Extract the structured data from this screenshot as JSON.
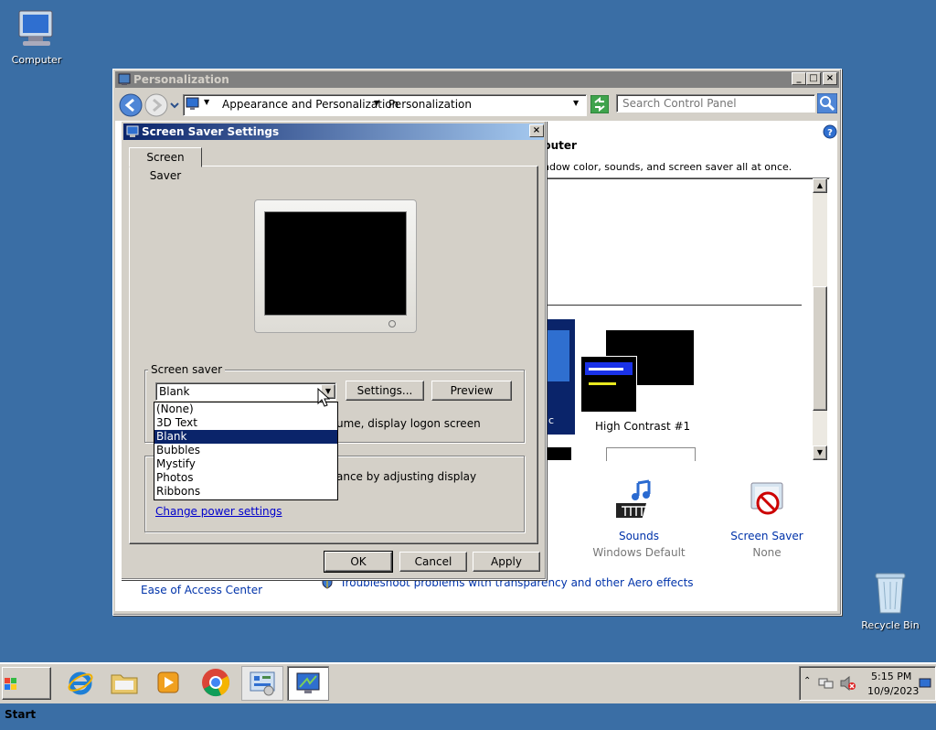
{
  "desktop": {
    "computer_label": "Computer",
    "recycle_label": "Recycle Bin"
  },
  "personalization": {
    "title": "Personalization",
    "breadcrumb": [
      "Appearance and Personalization",
      "Personalization"
    ],
    "search_placeholder": "Search Control Panel",
    "heading_fragment": "puter",
    "subtitle_fragment": "ndow color, sounds, and screen saver all at once.",
    "theme_partial_text": "ic",
    "theme_high_contrast": "High Contrast #1",
    "sounds_label": "Sounds",
    "sounds_value": "Windows Default",
    "screensaver_label": "Screen Saver",
    "screensaver_value": "None",
    "ease_link": "Ease of Access Center",
    "troubleshoot_link": "Troubleshoot problems with transparency and other Aero effects"
  },
  "dialog": {
    "title": "Screen Saver Settings",
    "tab": "Screen Saver",
    "group_label": "Screen saver",
    "selected": "Blank",
    "settings_btn": "Settings...",
    "preview_btn": "Preview",
    "options": [
      "(None)",
      "3D Text",
      "Blank",
      "Bubbles",
      "Mystify",
      "Photos",
      "Ribbons"
    ],
    "resume_text_fragment": "ume, display logon screen",
    "power_text_fragment": "ance by adjusting display",
    "power_link": "Change power settings",
    "ok": "OK",
    "cancel": "Cancel",
    "apply": "Apply"
  },
  "taskbar": {
    "start": "Start",
    "time": "5:15 PM",
    "date": "10/9/2023"
  },
  "colors": {
    "desktop": "#3a6ea5",
    "selection": "#0a246a"
  }
}
